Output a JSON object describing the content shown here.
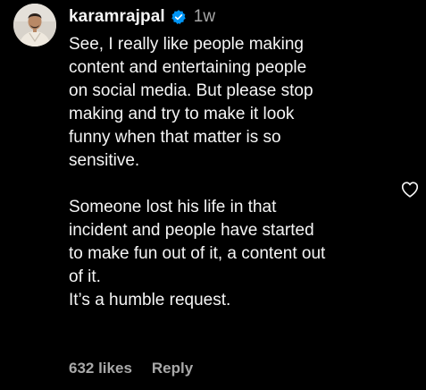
{
  "comment": {
    "username": "karamrajpal",
    "verified_icon": "verified-badge-icon",
    "timestamp": "1w",
    "paragraphs": [
      "See, I really like people making\ncontent and entertaining people\non social media. But please stop\nmaking and try to make it look\nfunny when that matter is so\nsensitive.",
      "Someone lost his life in that\nincident and people have started\nto make fun out of it, a content out\nof it.\nIt’s a humble request."
    ],
    "likes": "632 likes",
    "reply_label": "Reply",
    "like_icon": "heart-outline-icon"
  },
  "colors": {
    "background": "#000000",
    "text": "#f5f5f5",
    "secondary": "#a8a8a8",
    "verified": "#0095f6"
  }
}
